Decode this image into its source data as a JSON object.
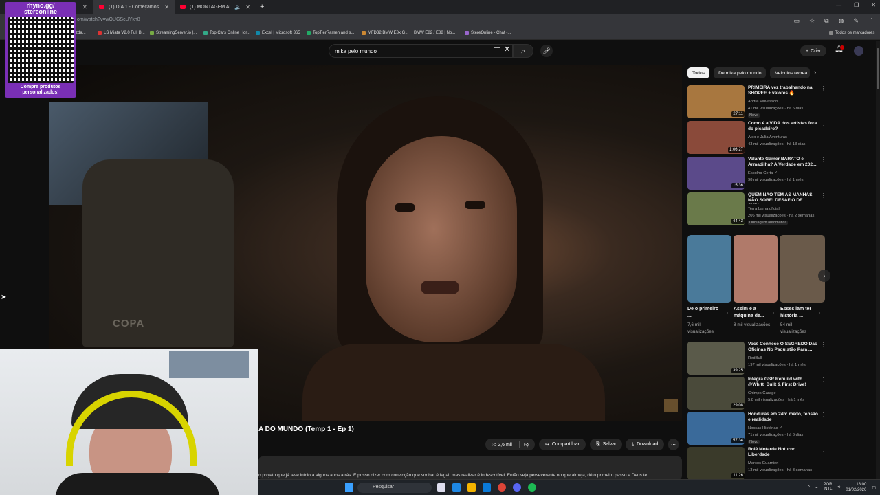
{
  "browser": {
    "tabs": [
      {
        "title": ""
      },
      {
        "title": "(1) DIA 1 - Começamos mais u"
      },
      {
        "title": "(1) MONTAGEM ARTESANA"
      }
    ],
    "url": "om/watch?v=wOUGScUYkh8",
    "bookmarks": [
      "zda...",
      "LS Miata V2.0 Full B...",
      "StreamingServer.io |...",
      "Top Cars Online Hor...",
      "Excel | Microsoft 365",
      "TopTierRamen and s...",
      "MFD32 BMW E8x G...",
      "BMW E82 / E88 | No...",
      "StereOnline - Chat -..."
    ],
    "all_bookmarks": "Todos os marcadores"
  },
  "overlay": {
    "header": "rhyno.gg/\nstereonline",
    "caption": "Compre produtos personalizados!"
  },
  "youtube": {
    "search_value": "mika pelo mundo",
    "create_label": "Criar",
    "video_title": "A DO MUNDO (Temp 1 - Ep 1)",
    "video_watermark": "COPA",
    "actions": {
      "likes": "2,6 mil",
      "share": "Compartilhar",
      "save": "Salvar",
      "download": "Download"
    },
    "description": "n projeto que já teve início a alguns anos atrás. E posso dizer com convicção que sonhar é legal, mas realizar é indescritível. Então seja perseverante no que almeja, dê o primeiro passo e Deus te"
  },
  "sidebar": {
    "chips": [
      "Todos",
      "De mika pelo mundo",
      "Veículos recrea"
    ],
    "recs_top": [
      {
        "title": "PRIMEIRA vez trabalhando na SHOPEE + valores 🔥",
        "channel": "André Valvassori",
        "meta": "41 mil visualizações · há 6 dias",
        "badge": "Novo",
        "duration": "27:11",
        "color": "#a8773f"
      },
      {
        "title": "Como é a VIDA dos artistas fora do picadeiro?",
        "channel": "Alex e Julia Aventuras",
        "meta": "43 mil visualizações · há 13 dias",
        "badge": "",
        "duration": "1:06:27",
        "color": "#8a4a3a"
      },
      {
        "title": "Volante Gamer BARATO é Armadilha? A Verdade em 202...",
        "channel": "Escolha Certa ✓",
        "meta": "98 mil visualizações · há 1 mês",
        "badge": "",
        "duration": "15:36",
        "color": "#5b4a8a"
      },
      {
        "title": "QUEM NÃO TEM AS MANHAS, NÃO SOBE! DESAFIO DE SUBI...",
        "channel": "Terra Lama oficial",
        "meta": "206 mil visualizações · há 2 semanas",
        "badge": "Dublagem automática",
        "duration": "44:43",
        "color": "#6a7a4a"
      }
    ],
    "shorts": [
      {
        "title": "De o primeiro ...",
        "views": "7,6 mil visualizações",
        "color": "#4a7a9a"
      },
      {
        "title": "Assim é a máquina de...",
        "views": "8 mil visualizações",
        "color": "#b07a6a"
      },
      {
        "title": "Esses iam ter história ...",
        "views": "54 mil visualizações",
        "color": "#6a5a4a"
      }
    ],
    "recs_bottom": [
      {
        "title": "Você Conhece O SEGREDO Das Oficinas No Paquistão Para ...",
        "channel": "RedBull",
        "meta": "197 mil visualizações · há 1 mês",
        "badge": "",
        "duration": "39:25",
        "color": "#5a5a4a"
      },
      {
        "title": "Integra GSR Rebuild with @Whitt_Built & First Drive!",
        "channel": "Chimps Garage",
        "meta": "5,8 mil visualizações · há 1 mês",
        "badge": "",
        "duration": "29:08",
        "color": "#4a4a3a"
      },
      {
        "title": "Honduras em 24h: medo, tensão e realidade",
        "channel": "Nossas Histórias ✓",
        "meta": "71 mil visualizações · há 6 dias",
        "badge": "Novo",
        "duration": "57:34",
        "color": "#3a6a9a"
      },
      {
        "title": "Rolê Motarde Noturno Liberdade",
        "channel": "Marcos Guarnieri",
        "meta": "13 mil visualizações · há 3 semanas",
        "badge": "",
        "duration": "11:26",
        "color": "#3a3a2a"
      }
    ]
  },
  "taskbar": {
    "search": "Pesquisar",
    "lang": "POR\nINTL",
    "time": "18:00",
    "date": "01/02/2026"
  }
}
